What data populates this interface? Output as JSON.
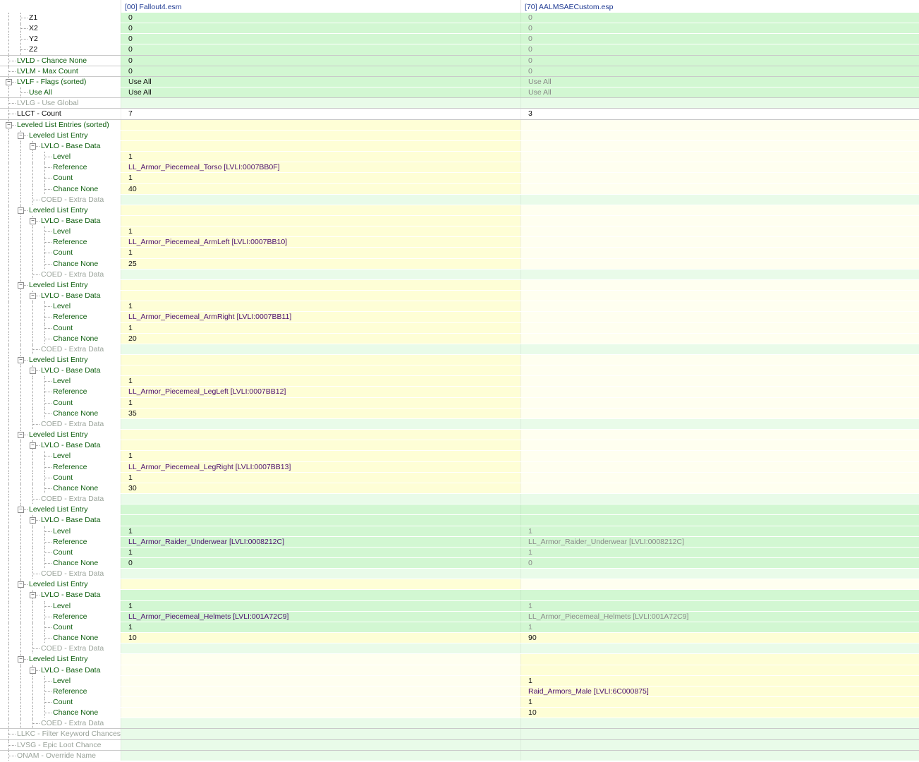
{
  "header": {
    "col0": "",
    "col1": "[00] Fallout4.esm",
    "col2": "[70] AALMSAECustom.esp"
  },
  "rows": [
    {
      "label": "Z1",
      "depth": 2,
      "toggle": "",
      "v1": "0",
      "v2": "0",
      "lc": "black",
      "v1c": "black",
      "v2c": "lgray",
      "bg1": "G",
      "bg2": "G",
      "sep": false
    },
    {
      "label": "X2",
      "depth": 2,
      "toggle": "",
      "v1": "0",
      "v2": "0",
      "lc": "black",
      "v1c": "black",
      "v2c": "lgray",
      "bg1": "G",
      "bg2": "G",
      "sep": false
    },
    {
      "label": "Y2",
      "depth": 2,
      "toggle": "",
      "v1": "0",
      "v2": "0",
      "lc": "black",
      "v1c": "black",
      "v2c": "lgray",
      "bg1": "G",
      "bg2": "G",
      "sep": false
    },
    {
      "label": "Z2",
      "depth": 2,
      "toggle": "",
      "v1": "0",
      "v2": "0",
      "lc": "black",
      "v1c": "black",
      "v2c": "lgray",
      "bg1": "G",
      "bg2": "G",
      "sep": true
    },
    {
      "label": "LVLD - Chance None",
      "depth": 1,
      "toggle": "",
      "v1": "0",
      "v2": "0",
      "lc": "green",
      "v1c": "black",
      "v2c": "lgray",
      "bg1": "G",
      "bg2": "G",
      "sep": true
    },
    {
      "label": "LVLM - Max Count",
      "depth": 1,
      "toggle": "",
      "v1": "0",
      "v2": "0",
      "lc": "green",
      "v1c": "black",
      "v2c": "lgray",
      "bg1": "G",
      "bg2": "G",
      "sep": true
    },
    {
      "label": "LVLF - Flags (sorted)",
      "depth": 1,
      "toggle": "−",
      "v1": "Use All",
      "v2": "Use All",
      "lc": "green",
      "v1c": "black",
      "v2c": "lgray",
      "bg1": "G",
      "bg2": "G",
      "sep": false
    },
    {
      "label": "Use All",
      "depth": 2,
      "toggle": "",
      "v1": "Use All",
      "v2": "Use All",
      "lc": "green",
      "v1c": "black",
      "v2c": "lgray",
      "bg1": "G",
      "bg2": "G",
      "sep": true
    },
    {
      "label": "LVLG - Use Global",
      "depth": 1,
      "toggle": "",
      "v1": "",
      "v2": "",
      "lc": "gray",
      "v1c": "black",
      "v2c": "lgray",
      "bg1": "LG",
      "bg2": "LG",
      "sep": true
    },
    {
      "label": "LLCT - Count",
      "depth": 1,
      "toggle": "",
      "v1": "7",
      "v2": "3",
      "lc": "black",
      "v1c": "black",
      "v2c": "black",
      "bg1": "W",
      "bg2": "W",
      "sep": true
    },
    {
      "label": "Leveled List Entries (sorted)",
      "depth": 1,
      "toggle": "−",
      "v1": "",
      "v2": "",
      "lc": "green",
      "v1c": "black",
      "v2c": "black",
      "bg1": "Y",
      "bg2": "LY",
      "sep": false
    },
    {
      "label": "Leveled List Entry",
      "depth": 2,
      "toggle": "−",
      "v1": "",
      "v2": "",
      "lc": "green",
      "v1c": "black",
      "v2c": "black",
      "bg1": "Y",
      "bg2": "LY",
      "sep": false
    },
    {
      "label": "LVLO - Base Data",
      "depth": 3,
      "toggle": "−",
      "v1": "",
      "v2": "",
      "lc": "green",
      "v1c": "black",
      "v2c": "black",
      "bg1": "Y",
      "bg2": "LY",
      "sep": false
    },
    {
      "label": "Level",
      "depth": 4,
      "toggle": "",
      "v1": "1",
      "v2": "",
      "lc": "green",
      "v1c": "black",
      "v2c": "black",
      "bg1": "Y",
      "bg2": "LY",
      "sep": false
    },
    {
      "label": "Reference",
      "depth": 4,
      "toggle": "",
      "v1": "LL_Armor_Piecemeal_Torso [LVLI:0007BB0F]",
      "v2": "",
      "lc": "green",
      "v1c": "purple",
      "v2c": "black",
      "bg1": "Y",
      "bg2": "LY",
      "sep": false
    },
    {
      "label": "Count",
      "depth": 4,
      "toggle": "",
      "v1": "1",
      "v2": "",
      "lc": "green",
      "v1c": "black",
      "v2c": "black",
      "bg1": "Y",
      "bg2": "LY",
      "sep": false
    },
    {
      "label": "Chance None",
      "depth": 4,
      "toggle": "",
      "v1": "40",
      "v2": "",
      "lc": "green",
      "v1c": "black",
      "v2c": "black",
      "bg1": "Y",
      "bg2": "LY",
      "sep": false
    },
    {
      "label": "COED - Extra Data",
      "depth": 3,
      "toggle": "",
      "v1": "",
      "v2": "",
      "lc": "gray",
      "v1c": "black",
      "v2c": "black",
      "bg1": "LG",
      "bg2": "LG",
      "sep": false
    },
    {
      "label": "Leveled List Entry",
      "depth": 2,
      "toggle": "−",
      "v1": "",
      "v2": "",
      "lc": "green",
      "v1c": "black",
      "v2c": "black",
      "bg1": "Y",
      "bg2": "LY",
      "sep": false
    },
    {
      "label": "LVLO - Base Data",
      "depth": 3,
      "toggle": "−",
      "v1": "",
      "v2": "",
      "lc": "green",
      "v1c": "black",
      "v2c": "black",
      "bg1": "Y",
      "bg2": "LY",
      "sep": false
    },
    {
      "label": "Level",
      "depth": 4,
      "toggle": "",
      "v1": "1",
      "v2": "",
      "lc": "green",
      "v1c": "black",
      "v2c": "black",
      "bg1": "Y",
      "bg2": "LY",
      "sep": false
    },
    {
      "label": "Reference",
      "depth": 4,
      "toggle": "",
      "v1": "LL_Armor_Piecemeal_ArmLeft [LVLI:0007BB10]",
      "v2": "",
      "lc": "green",
      "v1c": "purple",
      "v2c": "black",
      "bg1": "Y",
      "bg2": "LY",
      "sep": false
    },
    {
      "label": "Count",
      "depth": 4,
      "toggle": "",
      "v1": "1",
      "v2": "",
      "lc": "green",
      "v1c": "black",
      "v2c": "black",
      "bg1": "Y",
      "bg2": "LY",
      "sep": false
    },
    {
      "label": "Chance None",
      "depth": 4,
      "toggle": "",
      "v1": "25",
      "v2": "",
      "lc": "green",
      "v1c": "black",
      "v2c": "black",
      "bg1": "Y",
      "bg2": "LY",
      "sep": false
    },
    {
      "label": "COED - Extra Data",
      "depth": 3,
      "toggle": "",
      "v1": "",
      "v2": "",
      "lc": "gray",
      "v1c": "black",
      "v2c": "black",
      "bg1": "LG",
      "bg2": "LG",
      "sep": false
    },
    {
      "label": "Leveled List Entry",
      "depth": 2,
      "toggle": "−",
      "v1": "",
      "v2": "",
      "lc": "green",
      "v1c": "black",
      "v2c": "black",
      "bg1": "Y",
      "bg2": "LY",
      "sep": false
    },
    {
      "label": "LVLO - Base Data",
      "depth": 3,
      "toggle": "−",
      "v1": "",
      "v2": "",
      "lc": "green",
      "v1c": "black",
      "v2c": "black",
      "bg1": "Y",
      "bg2": "LY",
      "sep": false
    },
    {
      "label": "Level",
      "depth": 4,
      "toggle": "",
      "v1": "1",
      "v2": "",
      "lc": "green",
      "v1c": "black",
      "v2c": "black",
      "bg1": "Y",
      "bg2": "LY",
      "sep": false
    },
    {
      "label": "Reference",
      "depth": 4,
      "toggle": "",
      "v1": "LL_Armor_Piecemeal_ArmRight [LVLI:0007BB11]",
      "v2": "",
      "lc": "green",
      "v1c": "purple",
      "v2c": "black",
      "bg1": "Y",
      "bg2": "LY",
      "sep": false
    },
    {
      "label": "Count",
      "depth": 4,
      "toggle": "",
      "v1": "1",
      "v2": "",
      "lc": "green",
      "v1c": "black",
      "v2c": "black",
      "bg1": "Y",
      "bg2": "LY",
      "sep": false
    },
    {
      "label": "Chance None",
      "depth": 4,
      "toggle": "",
      "v1": "20",
      "v2": "",
      "lc": "green",
      "v1c": "black",
      "v2c": "black",
      "bg1": "Y",
      "bg2": "LY",
      "sep": false
    },
    {
      "label": "COED - Extra Data",
      "depth": 3,
      "toggle": "",
      "v1": "",
      "v2": "",
      "lc": "gray",
      "v1c": "black",
      "v2c": "black",
      "bg1": "LG",
      "bg2": "LG",
      "sep": false
    },
    {
      "label": "Leveled List Entry",
      "depth": 2,
      "toggle": "−",
      "v1": "",
      "v2": "",
      "lc": "green",
      "v1c": "black",
      "v2c": "black",
      "bg1": "Y",
      "bg2": "LY",
      "sep": false
    },
    {
      "label": "LVLO - Base Data",
      "depth": 3,
      "toggle": "−",
      "v1": "",
      "v2": "",
      "lc": "green",
      "v1c": "black",
      "v2c": "black",
      "bg1": "Y",
      "bg2": "LY",
      "sep": false
    },
    {
      "label": "Level",
      "depth": 4,
      "toggle": "",
      "v1": "1",
      "v2": "",
      "lc": "green",
      "v1c": "black",
      "v2c": "black",
      "bg1": "Y",
      "bg2": "LY",
      "sep": false
    },
    {
      "label": "Reference",
      "depth": 4,
      "toggle": "",
      "v1": "LL_Armor_Piecemeal_LegLeft [LVLI:0007BB12]",
      "v2": "",
      "lc": "green",
      "v1c": "purple",
      "v2c": "black",
      "bg1": "Y",
      "bg2": "LY",
      "sep": false
    },
    {
      "label": "Count",
      "depth": 4,
      "toggle": "",
      "v1": "1",
      "v2": "",
      "lc": "green",
      "v1c": "black",
      "v2c": "black",
      "bg1": "Y",
      "bg2": "LY",
      "sep": false
    },
    {
      "label": "Chance None",
      "depth": 4,
      "toggle": "",
      "v1": "35",
      "v2": "",
      "lc": "green",
      "v1c": "black",
      "v2c": "black",
      "bg1": "Y",
      "bg2": "LY",
      "sep": false
    },
    {
      "label": "COED - Extra Data",
      "depth": 3,
      "toggle": "",
      "v1": "",
      "v2": "",
      "lc": "gray",
      "v1c": "black",
      "v2c": "black",
      "bg1": "LG",
      "bg2": "LG",
      "sep": false
    },
    {
      "label": "Leveled List Entry",
      "depth": 2,
      "toggle": "−",
      "v1": "",
      "v2": "",
      "lc": "green",
      "v1c": "black",
      "v2c": "black",
      "bg1": "Y",
      "bg2": "LY",
      "sep": false
    },
    {
      "label": "LVLO - Base Data",
      "depth": 3,
      "toggle": "−",
      "v1": "",
      "v2": "",
      "lc": "green",
      "v1c": "black",
      "v2c": "black",
      "bg1": "Y",
      "bg2": "LY",
      "sep": false
    },
    {
      "label": "Level",
      "depth": 4,
      "toggle": "",
      "v1": "1",
      "v2": "",
      "lc": "green",
      "v1c": "black",
      "v2c": "black",
      "bg1": "Y",
      "bg2": "LY",
      "sep": false
    },
    {
      "label": "Reference",
      "depth": 4,
      "toggle": "",
      "v1": "LL_Armor_Piecemeal_LegRight [LVLI:0007BB13]",
      "v2": "",
      "lc": "green",
      "v1c": "purple",
      "v2c": "black",
      "bg1": "Y",
      "bg2": "LY",
      "sep": false
    },
    {
      "label": "Count",
      "depth": 4,
      "toggle": "",
      "v1": "1",
      "v2": "",
      "lc": "green",
      "v1c": "black",
      "v2c": "black",
      "bg1": "Y",
      "bg2": "LY",
      "sep": false
    },
    {
      "label": "Chance None",
      "depth": 4,
      "toggle": "",
      "v1": "30",
      "v2": "",
      "lc": "green",
      "v1c": "black",
      "v2c": "black",
      "bg1": "Y",
      "bg2": "LY",
      "sep": false
    },
    {
      "label": "COED - Extra Data",
      "depth": 3,
      "toggle": "",
      "v1": "",
      "v2": "",
      "lc": "gray",
      "v1c": "black",
      "v2c": "black",
      "bg1": "LG",
      "bg2": "LG",
      "sep": false
    },
    {
      "label": "Leveled List Entry",
      "depth": 2,
      "toggle": "−",
      "v1": "",
      "v2": "",
      "lc": "green",
      "v1c": "black",
      "v2c": "black",
      "bg1": "G",
      "bg2": "G",
      "sep": false
    },
    {
      "label": "LVLO - Base Data",
      "depth": 3,
      "toggle": "−",
      "v1": "",
      "v2": "",
      "lc": "green",
      "v1c": "black",
      "v2c": "black",
      "bg1": "G",
      "bg2": "G",
      "sep": false
    },
    {
      "label": "Level",
      "depth": 4,
      "toggle": "",
      "v1": "1",
      "v2": "1",
      "lc": "green",
      "v1c": "black",
      "v2c": "lgray",
      "bg1": "G",
      "bg2": "G",
      "sep": false
    },
    {
      "label": "Reference",
      "depth": 4,
      "toggle": "",
      "v1": "LL_Armor_Raider_Underwear [LVLI:0008212C]",
      "v2": "LL_Armor_Raider_Underwear [LVLI:0008212C]",
      "lc": "green",
      "v1c": "purple",
      "v2c": "lgray",
      "bg1": "G",
      "bg2": "G",
      "sep": false
    },
    {
      "label": "Count",
      "depth": 4,
      "toggle": "",
      "v1": "1",
      "v2": "1",
      "lc": "green",
      "v1c": "black",
      "v2c": "lgray",
      "bg1": "G",
      "bg2": "G",
      "sep": false
    },
    {
      "label": "Chance None",
      "depth": 4,
      "toggle": "",
      "v1": "0",
      "v2": "0",
      "lc": "green",
      "v1c": "black",
      "v2c": "lgray",
      "bg1": "G",
      "bg2": "G",
      "sep": false
    },
    {
      "label": "COED - Extra Data",
      "depth": 3,
      "toggle": "",
      "v1": "",
      "v2": "",
      "lc": "gray",
      "v1c": "black",
      "v2c": "black",
      "bg1": "LG",
      "bg2": "LG",
      "sep": false
    },
    {
      "label": "Leveled List Entry",
      "depth": 2,
      "toggle": "−",
      "v1": "",
      "v2": "",
      "lc": "green",
      "v1c": "black",
      "v2c": "black",
      "bg1": "Y",
      "bg2": "LY",
      "sep": false
    },
    {
      "label": "LVLO - Base Data",
      "depth": 3,
      "toggle": "−",
      "v1": "",
      "v2": "",
      "lc": "green",
      "v1c": "black",
      "v2c": "black",
      "bg1": "G",
      "bg2": "G",
      "sep": false
    },
    {
      "label": "Level",
      "depth": 4,
      "toggle": "",
      "v1": "1",
      "v2": "1",
      "lc": "green",
      "v1c": "black",
      "v2c": "lgray",
      "bg1": "G",
      "bg2": "G",
      "sep": false
    },
    {
      "label": "Reference",
      "depth": 4,
      "toggle": "",
      "v1": "LL_Armor_Piecemeal_Helmets [LVLI:001A72C9]",
      "v2": "LL_Armor_Piecemeal_Helmets [LVLI:001A72C9]",
      "lc": "green",
      "v1c": "purple",
      "v2c": "lgray",
      "bg1": "G",
      "bg2": "G",
      "sep": false
    },
    {
      "label": "Count",
      "depth": 4,
      "toggle": "",
      "v1": "1",
      "v2": "1",
      "lc": "green",
      "v1c": "black",
      "v2c": "lgray",
      "bg1": "G",
      "bg2": "G",
      "sep": false
    },
    {
      "label": "Chance None",
      "depth": 4,
      "toggle": "",
      "v1": "10",
      "v2": "90",
      "lc": "green",
      "v1c": "black",
      "v2c": "black",
      "bg1": "Y",
      "bg2": "Y",
      "sep": false
    },
    {
      "label": "COED - Extra Data",
      "depth": 3,
      "toggle": "",
      "v1": "",
      "v2": "",
      "lc": "gray",
      "v1c": "black",
      "v2c": "black",
      "bg1": "LG",
      "bg2": "LG",
      "sep": false
    },
    {
      "label": "Leveled List Entry",
      "depth": 2,
      "toggle": "−",
      "v1": "",
      "v2": "",
      "lc": "green",
      "v1c": "black",
      "v2c": "black",
      "bg1": "LY",
      "bg2": "Y",
      "sep": false
    },
    {
      "label": "LVLO - Base Data",
      "depth": 3,
      "toggle": "−",
      "v1": "",
      "v2": "",
      "lc": "green",
      "v1c": "black",
      "v2c": "black",
      "bg1": "LY",
      "bg2": "Y",
      "sep": false
    },
    {
      "label": "Level",
      "depth": 4,
      "toggle": "",
      "v1": "",
      "v2": "1",
      "lc": "green",
      "v1c": "black",
      "v2c": "black",
      "bg1": "LY",
      "bg2": "Y",
      "sep": false
    },
    {
      "label": "Reference",
      "depth": 4,
      "toggle": "",
      "v1": "",
      "v2": "Raid_Armors_Male [LVLI:6C000875]",
      "lc": "green",
      "v1c": "black",
      "v2c": "purple",
      "bg1": "LY",
      "bg2": "Y",
      "sep": false
    },
    {
      "label": "Count",
      "depth": 4,
      "toggle": "",
      "v1": "",
      "v2": "1",
      "lc": "green",
      "v1c": "black",
      "v2c": "black",
      "bg1": "LY",
      "bg2": "Y",
      "sep": false
    },
    {
      "label": "Chance None",
      "depth": 4,
      "toggle": "",
      "v1": "",
      "v2": "10",
      "lc": "green",
      "v1c": "black",
      "v2c": "black",
      "bg1": "LY",
      "bg2": "Y",
      "sep": false
    },
    {
      "label": "COED - Extra Data",
      "depth": 3,
      "toggle": "",
      "v1": "",
      "v2": "",
      "lc": "gray",
      "v1c": "black",
      "v2c": "black",
      "bg1": "LG",
      "bg2": "LG",
      "sep": true
    },
    {
      "label": "LLKC - Filter Keyword Chances",
      "depth": 1,
      "toggle": "",
      "v1": "",
      "v2": "",
      "lc": "gray",
      "v1c": "black",
      "v2c": "black",
      "bg1": "LG",
      "bg2": "LG",
      "sep": true
    },
    {
      "label": "LVSG - Epic Loot Chance",
      "depth": 1,
      "toggle": "",
      "v1": "",
      "v2": "",
      "lc": "gray",
      "v1c": "black",
      "v2c": "black",
      "bg1": "LG",
      "bg2": "LG",
      "sep": true
    },
    {
      "label": "ONAM - Override Name",
      "depth": 1,
      "toggle": "",
      "v1": "",
      "v2": "",
      "lc": "gray",
      "v1c": "black",
      "v2c": "black",
      "bg1": "LG",
      "bg2": "LG",
      "sep": false
    }
  ]
}
